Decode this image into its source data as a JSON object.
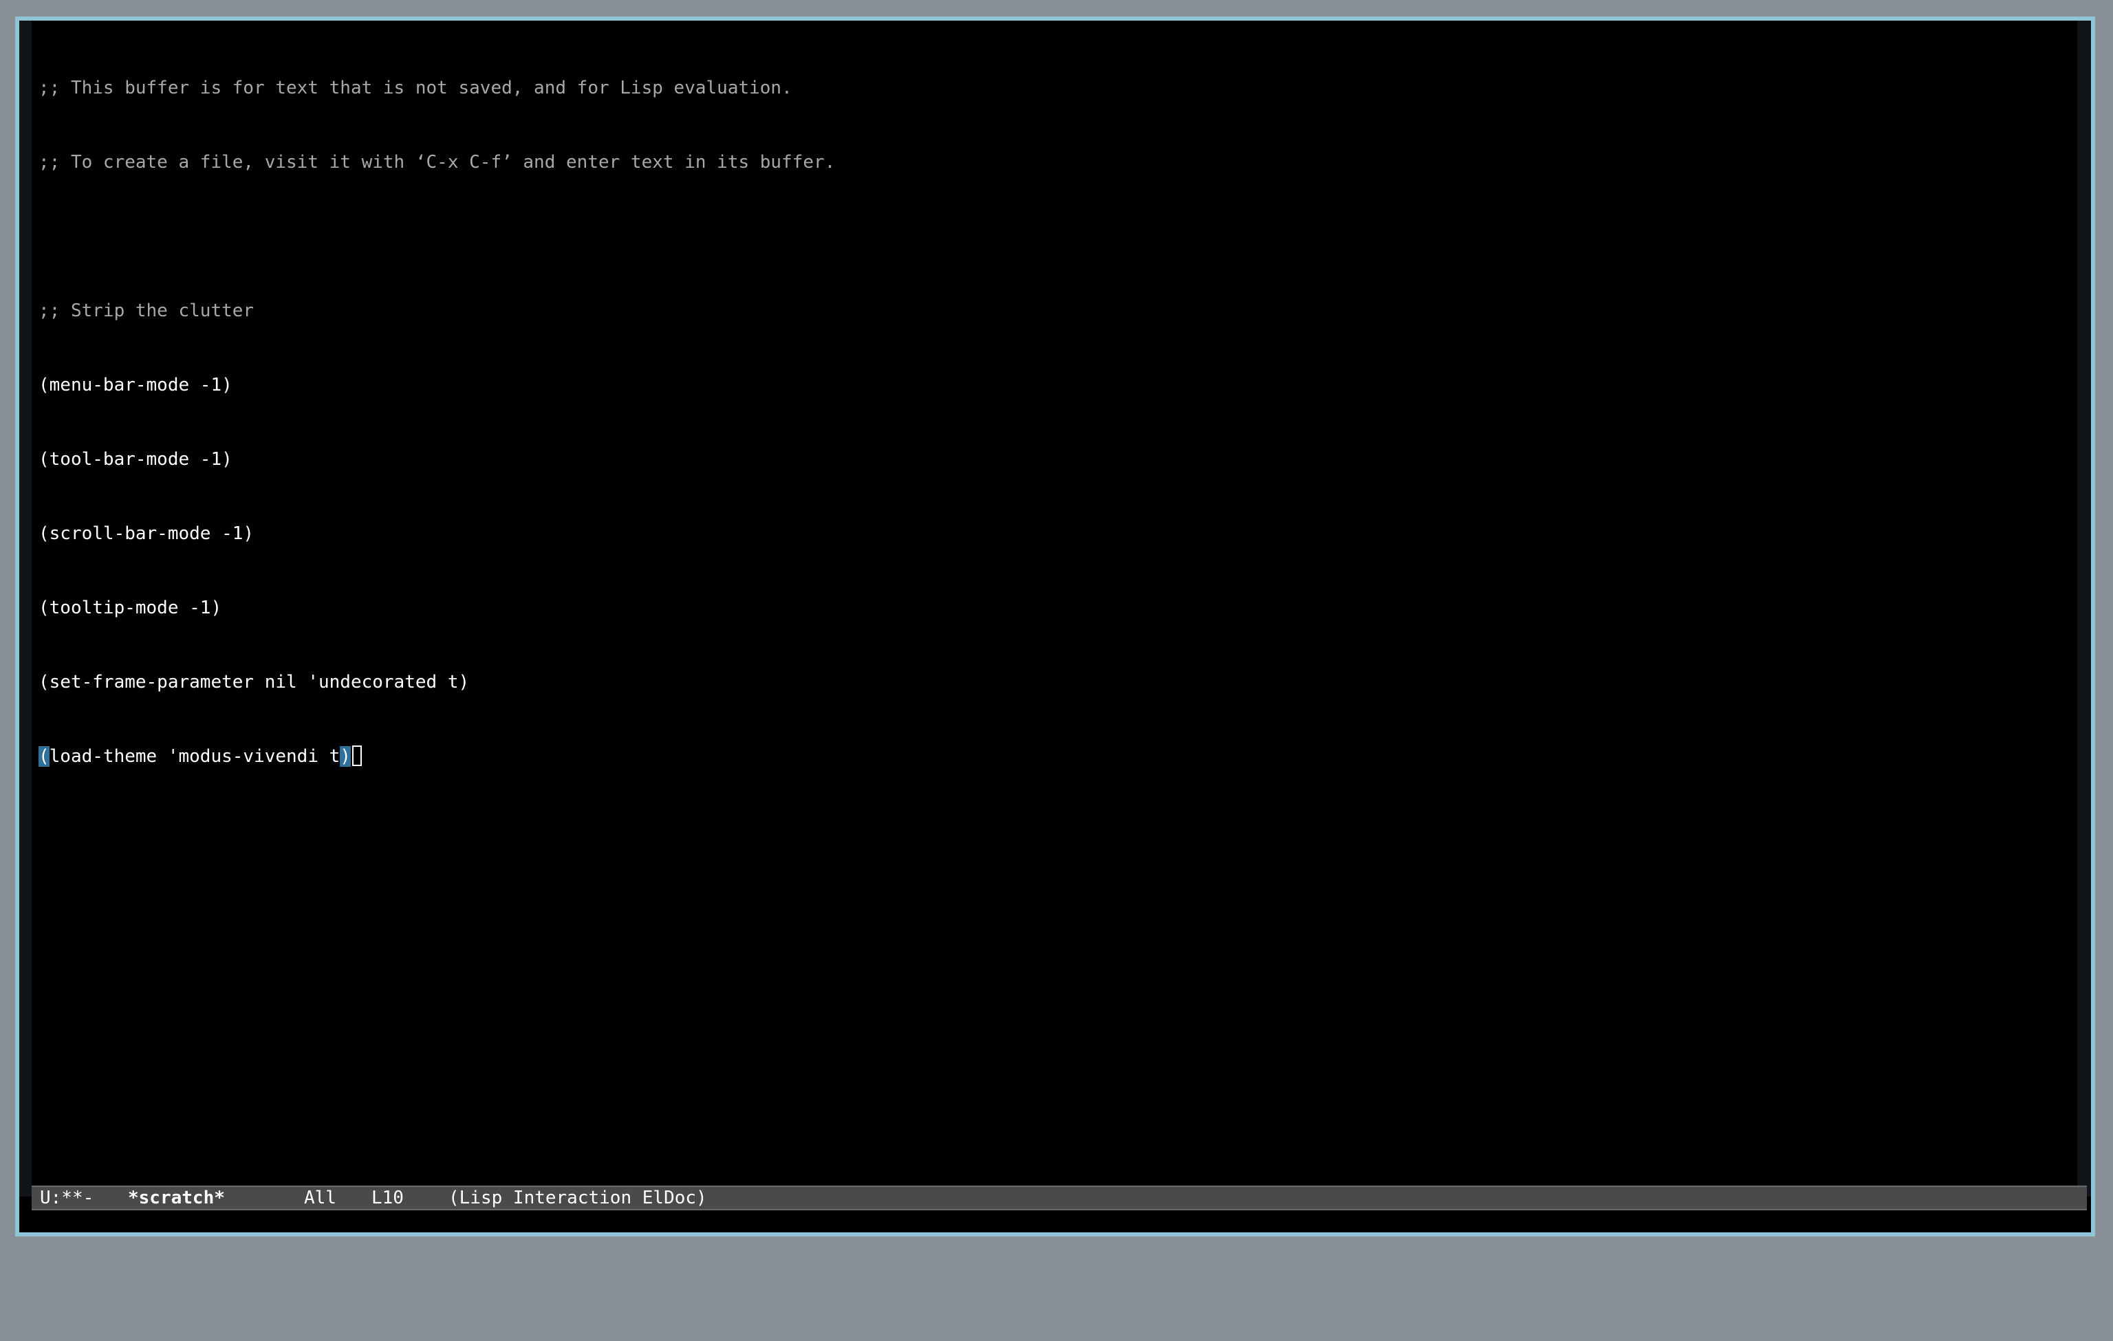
{
  "buffer": {
    "lines": [
      ";; This buffer is for text that is not saved, and for Lisp evaluation.",
      ";; To create a file, visit it with ‘C-x C-f’ and enter text in its buffer.",
      "",
      ";; Strip the clutter",
      "(menu-bar-mode -1)",
      "(tool-bar-mode -1)",
      "(scroll-bar-mode -1)",
      "(tooltip-mode -1)",
      "(set-frame-parameter nil 'undecorated t)"
    ],
    "last_line": {
      "open_paren": "(",
      "body": "load-theme 'modus-vivendi t",
      "close_paren": ")"
    }
  },
  "mode_line": {
    "status": "U:**-",
    "buffer_name": "*scratch*",
    "position": "All",
    "line_number": "L10",
    "modes": "(Lisp Interaction ElDoc)"
  },
  "echo_area": {
    "text": ""
  },
  "colors": {
    "frame_border": "#8fc3d6",
    "background": "#000000",
    "foreground": "#ffffff",
    "comment": "#a8a8a8",
    "paren_match": "#2f6f9a",
    "mode_line_bg": "#4a4a4a"
  }
}
